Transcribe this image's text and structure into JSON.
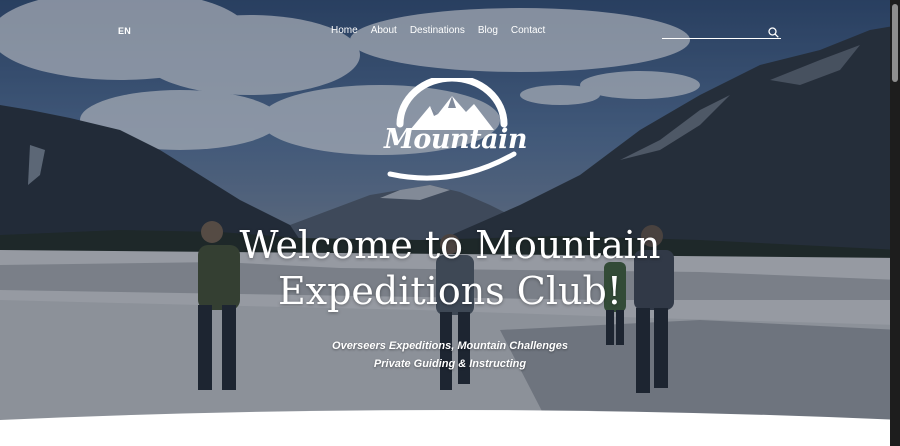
{
  "header": {
    "language": "EN",
    "nav": [
      "Home",
      "About",
      "Destinations",
      "Blog",
      "Contact"
    ],
    "search": {
      "value": "",
      "placeholder": "",
      "icon": "search-icon"
    }
  },
  "logo": {
    "text": "Mountain",
    "icon": "mountain-logo-icon"
  },
  "hero": {
    "title_line1": "Welcome to Mountain",
    "title_line2": "Expeditions Club!",
    "subtitle_line1": "Overseers Expeditions, Mountain Challenges",
    "subtitle_line2": "Private Guiding & Instructing"
  },
  "colors": {
    "text": "#ffffff",
    "sky": "#2e4a72",
    "bottom": "#ffffff"
  }
}
